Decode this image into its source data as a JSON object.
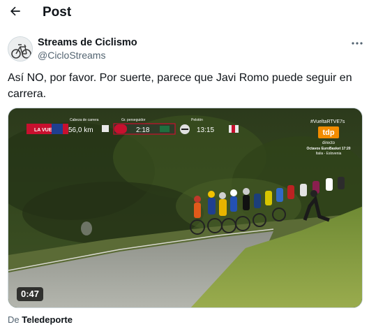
{
  "header": {
    "title": "Post"
  },
  "author": {
    "name": "Streams de Ciclismo",
    "handle": "@CicloStreams"
  },
  "tweet": {
    "text": "Así NO, por favor. Por suerte, parece que Javi Romo puede seguir en carrera."
  },
  "video": {
    "duration": "0:47",
    "overlay": {
      "race_logo": "LA VUELTA",
      "label_1": "Cabeza de carrera",
      "distance": "56,0 km",
      "label_2": "Gr. perseguidor",
      "gap_1": "2:18",
      "label_3": "Pelotón",
      "gap_2": "13:15",
      "hashtag": "#VueltaRTVE7s",
      "channel": "tdp",
      "channel_sub": "directo",
      "promo_line_1": "Octavos EuroBasket 17:20",
      "promo_line_2": "Italia - Eslovenia"
    }
  },
  "source": {
    "prefix": "De",
    "name": "Teledeporte"
  }
}
